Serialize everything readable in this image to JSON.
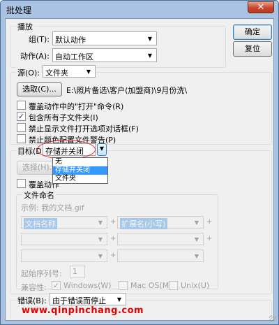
{
  "window": {
    "title": "批处理",
    "close_glyph": "✕"
  },
  "play": {
    "legend": "播放",
    "set_label": "组(T):",
    "set_value": "默认动作",
    "action_label": "动作(A):",
    "action_value": "自动工作区"
  },
  "buttons": {
    "ok": "确定",
    "reset": "复位"
  },
  "source": {
    "label": "源(O):",
    "value": "文件夹",
    "choose_button": "选取(C)...",
    "path": "E:\\照片备选\\客户(加盟商)\\9月份洗\\",
    "options": [
      {
        "label": "覆盖动作中的\"打开\"命令(R)",
        "checked": false
      },
      {
        "label": "包含所有子文件夹(I)",
        "checked": true
      },
      {
        "label": "禁止显示文件打开选项对话框(F)",
        "checked": false
      },
      {
        "label": "禁止颜色配置文件警告(P)",
        "checked": false
      }
    ]
  },
  "destination": {
    "label": "目标(D):",
    "value": "存储并关闭",
    "choose_button": "选择(H)...",
    "override_label": "覆盖动作",
    "dropdown_options": [
      {
        "label": "无",
        "selected": false
      },
      {
        "label": "存储并关闭",
        "selected": true
      },
      {
        "label": "文件夹",
        "selected": false
      }
    ],
    "file_naming": {
      "legend": "文件命名",
      "example": "示例: 我的文档.gif",
      "row1_left": "文档名称",
      "row1_right": "扩展名(小写)",
      "plus": "+",
      "serial_label": "起始序列号:",
      "serial_value": "1",
      "compat_label": "兼容性:",
      "compat": [
        {
          "label": "Windows(W)",
          "checked": true
        },
        {
          "label": "Mac OS(M)",
          "checked": false
        },
        {
          "label": "Unix(U)",
          "checked": false
        }
      ]
    }
  },
  "errors": {
    "label": "错误(B):",
    "value": "由于错误而停止"
  },
  "watermark": "www.qinpinchang.com",
  "colors": {
    "accent": "#3399ff",
    "highlight_ellipse": "#e02020",
    "watermark": "#e00000"
  }
}
